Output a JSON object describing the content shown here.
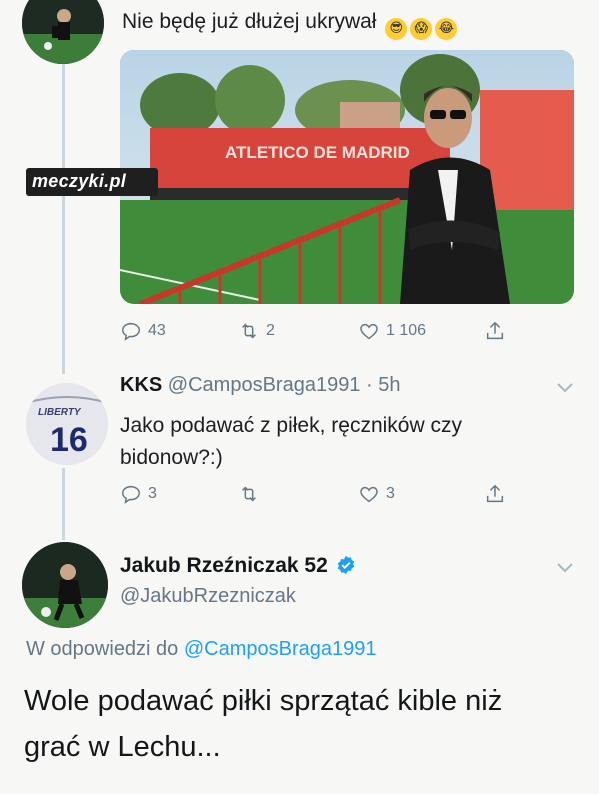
{
  "top_tweet": {
    "text": "Nie będę już dłużej ukrywał",
    "emojis": [
      "😎",
      "😱",
      "😂"
    ],
    "photo": {
      "banner_text": "ATLETICO DE MADRID"
    },
    "stats": {
      "replies": "43",
      "retweets": "2",
      "likes": "1 106"
    }
  },
  "watermark": {
    "text": "meczyki.pl"
  },
  "reply_tweet": {
    "name": "KKS",
    "handle": "@CamposBraga1991",
    "time": "· 5h",
    "text_line1": "Jako podawać z piłek, ręczników czy",
    "text_line2": "bidonow?:)",
    "avatar_text": "16",
    "avatar_caption": "LIBERTY",
    "stats": {
      "replies": "3",
      "retweets": "",
      "likes": "3"
    }
  },
  "main_tweet": {
    "name": "Jakub Rzeźniczak 52",
    "handle": "@JakubRzezniczak",
    "reply_to_prefix": "W odpowiedzi do",
    "reply_to_handle": "@CamposBraga1991",
    "text_line1": "Wole podawać piłki sprzątać kible niż",
    "text_line2": "grać w Lechu..."
  },
  "colors": {
    "verified": "#1da1f2",
    "link": "#1da1f2",
    "muted": "#657786"
  }
}
